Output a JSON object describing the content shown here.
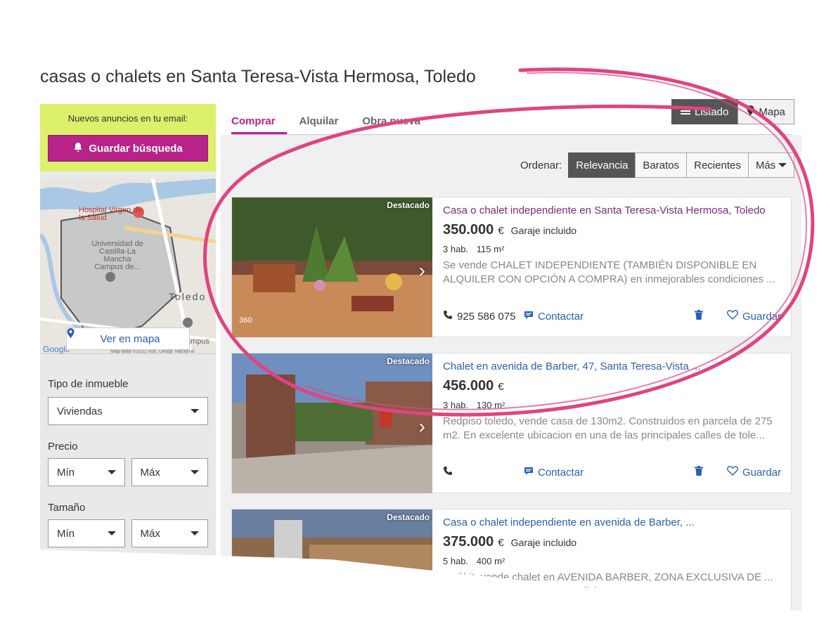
{
  "page": {
    "title": "casas o chalets en Santa Teresa-Vista Hermosa, Toledo"
  },
  "sidebar": {
    "email_label": "Nuevos anuncios en tu email:",
    "save_search": "Guardar búsqueda",
    "map": {
      "ver_en_mapa": "Ver en mapa",
      "labels": [
        "Hospital Virgen de la Salud",
        "Universidad de Castilla-La Mancha Campus de...",
        "Toledo",
        "Campus",
        "Google",
        "Map data ©2022 Inst. Geogr. Nacional"
      ]
    },
    "filters": {
      "tipo_label": "Tipo de inmueble",
      "tipo_value": "Viviendas",
      "precio_label": "Precio",
      "precio_min": "Mín",
      "precio_max": "Máx",
      "tamano_label": "Tamaño",
      "tamano_min": "Mín",
      "tamano_max": "Máx"
    }
  },
  "tabs": [
    "Comprar",
    "Alquilar",
    "Obra nueva"
  ],
  "view_switch": {
    "listado": "Listado",
    "mapa": "Mapa"
  },
  "sort": {
    "label": "Ordenar:",
    "options": [
      "Relevancia",
      "Baratos",
      "Recientes",
      "Más"
    ]
  },
  "listings": [
    {
      "badge": "Destacado",
      "tag": "360",
      "title": "Casa o chalet independiente en Santa Teresa-Vista Hermosa, Toledo",
      "price": "350.000",
      "currency": "€",
      "extra": "Garaje incluido",
      "rooms": "3 hab.",
      "size": "115 m²",
      "description": "Se vende CHALET INDEPENDIENTE (TAMBIÉN DISPONIBLE EN ALQUILER CON OPCIÓN A COMPRA) en inmejorables condiciones ...",
      "phone": "925 586 075",
      "contact": "Contactar",
      "save": "Guardar"
    },
    {
      "badge": "Destacado",
      "title": "Chalet en avenida de Barber, 47, Santa Teresa-Vista ...",
      "price": "456.000",
      "currency": "€",
      "extra": "",
      "rooms": "3 hab.",
      "size": "130 m²",
      "description": "Redpiso toledo, vende casa de 130m2. Construidos en parcela de 275 m2. En excelente ubicacion en una de las principales calles de tole...",
      "phone": "",
      "contact": "Contactar",
      "save": "Guardar"
    },
    {
      "badge": "Destacado",
      "title": "Casa o chalet independiente en avenida de Barber, ...",
      "price": "375.000",
      "currency": "€",
      "extra": "Garaje incluido",
      "rooms": "5 hab.",
      "size": "400 m²",
      "description": "amâbit, vende chalet en AVENIDA BARBER, ZONA EXCLUSIVA DE ... de la Salud. La vivienda esta divi...",
      "phone": "",
      "contact": "",
      "save": ""
    }
  ],
  "colors": {
    "brand": "#b8238a",
    "highlight": "#dcf06b",
    "link": "#2b5fb4",
    "annotation": "#e0447f"
  }
}
